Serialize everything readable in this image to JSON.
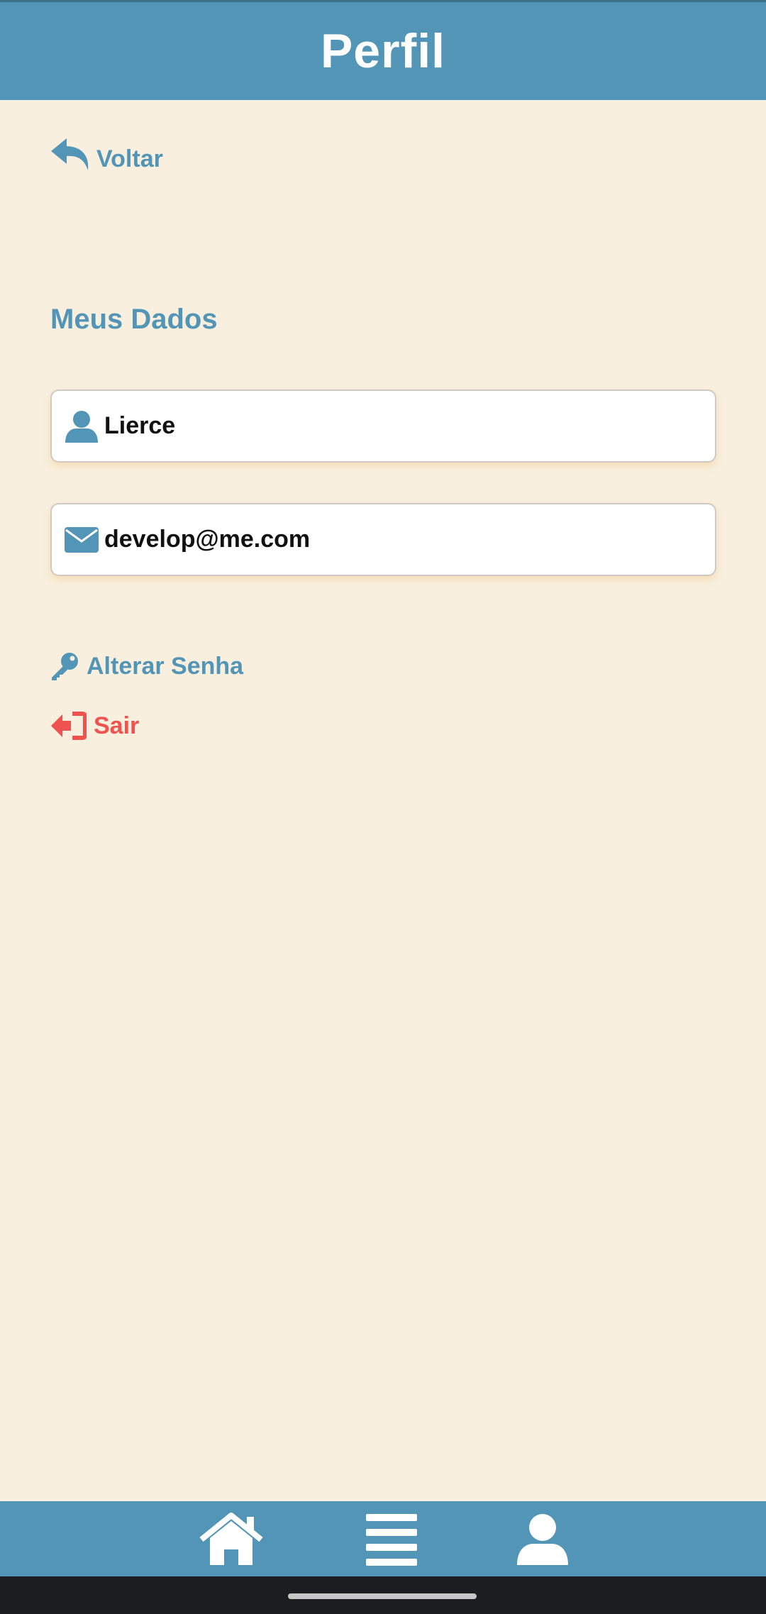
{
  "header": {
    "title": "Perfil"
  },
  "back": {
    "label": "Voltar",
    "icon": "reply-icon"
  },
  "section": {
    "title": "Meus Dados"
  },
  "fields": [
    {
      "icon": "user-icon",
      "value": "Lierce"
    },
    {
      "icon": "envelope-icon",
      "value": "develop@me.com"
    }
  ],
  "actions": {
    "change_password": {
      "label": "Alterar Senha",
      "icon": "key-icon"
    },
    "logout": {
      "label": "Sair",
      "icon": "sign-out-icon"
    }
  },
  "bottom_nav": {
    "items": [
      {
        "name": "home",
        "icon": "home-icon"
      },
      {
        "name": "list",
        "icon": "list-icon"
      },
      {
        "name": "profile",
        "icon": "user-icon"
      }
    ]
  },
  "colors": {
    "primary": "#5295b6",
    "background": "#f8efdf",
    "danger": "#ef5350",
    "field_bg": "#ffffff"
  }
}
